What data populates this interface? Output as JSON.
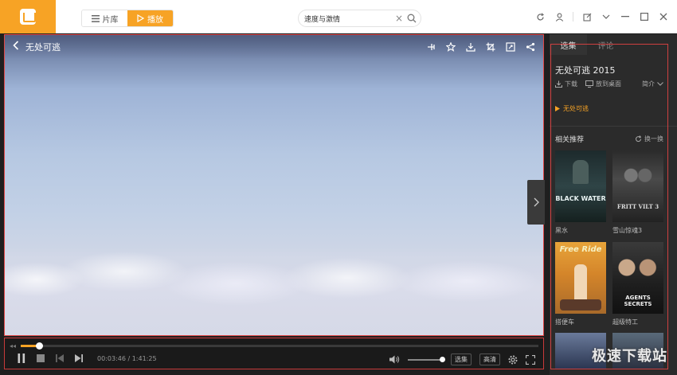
{
  "header": {
    "nav": [
      {
        "label": "片库",
        "icon": "menu-icon"
      },
      {
        "label": "播放",
        "icon": "play-outline-icon"
      }
    ],
    "search": {
      "value": "速度与激情",
      "placeholder": ""
    },
    "accent": "#f7a325"
  },
  "player": {
    "title": "无处可逃",
    "time_current": "00:03:46",
    "time_total": "1:41:25",
    "time_sep": " / ",
    "progress_fraction": 0.036,
    "volume_fraction": 0.95,
    "select_episodes_label": "选集",
    "quality_label": "高清"
  },
  "panel": {
    "tabs": [
      "选集",
      "评论"
    ],
    "movie_title": "无处可逃 2015",
    "download_label": "下载",
    "desktop_label": "放到桌面",
    "intro_label": "简介",
    "episode_label": "无处可逃",
    "recommend_title": "相关推荐",
    "refresh_label": "换一换",
    "recommendations": [
      {
        "title": "黑水",
        "poster_text": "BLACK WATER"
      },
      {
        "title": "雪山惊魂3",
        "poster_text": "FRITT VILT 3"
      },
      {
        "title": "搭便车",
        "poster_text": "Free Ride"
      },
      {
        "title": "超级特工",
        "poster_text": "AGENTS SECRETS"
      }
    ]
  },
  "watermark": "极速下载站"
}
